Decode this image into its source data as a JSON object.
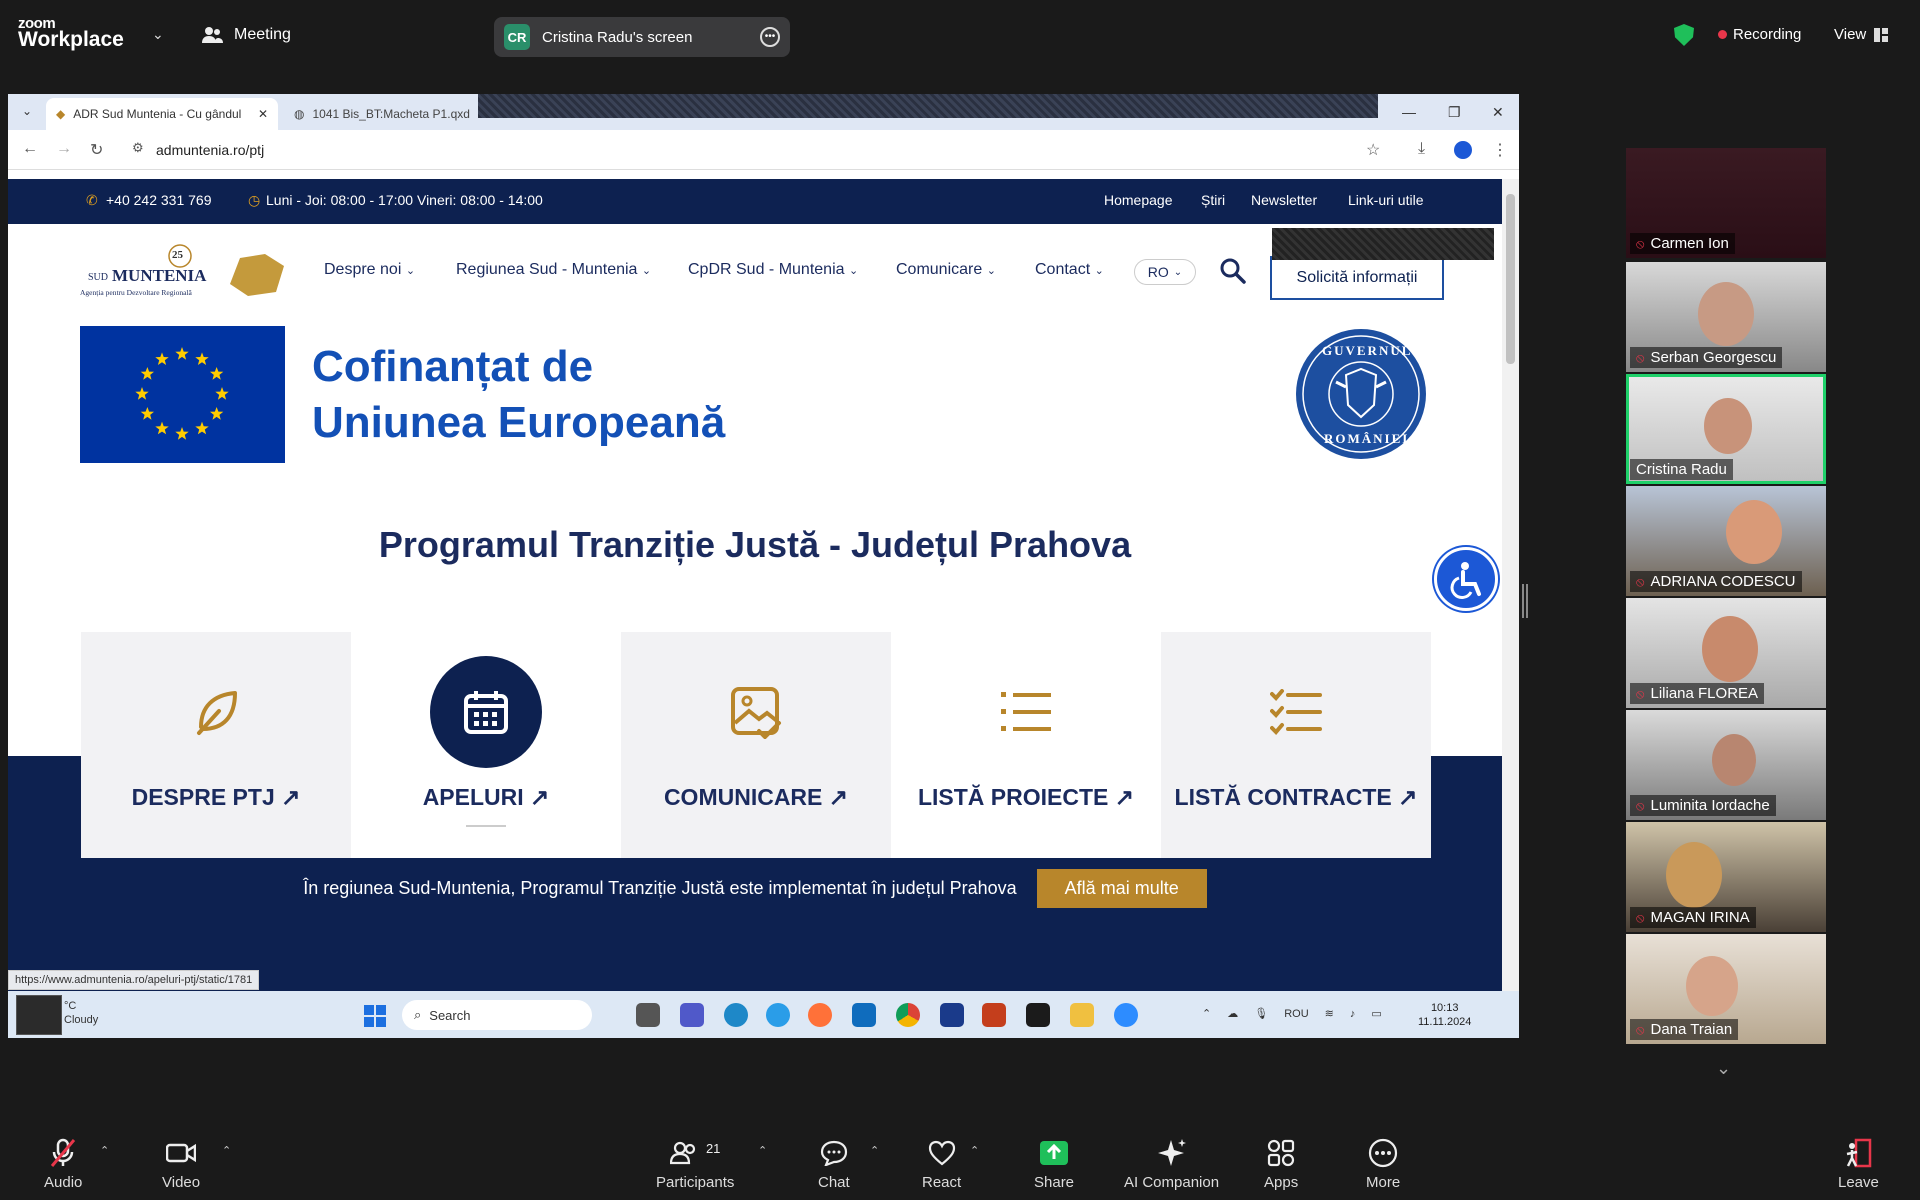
{
  "zoom": {
    "brand_top": "zoom",
    "brand_bottom": "Workplace",
    "meeting_label": "Meeting",
    "screen_initials": "CR",
    "screen_owner": "Cristina Radu's screen",
    "recording_label": "Recording",
    "view_label": "View"
  },
  "browser": {
    "tab1": "ADR Sud Muntenia - Cu gândul",
    "tab2": "1041 Bis_BT:Macheta P1.qxd",
    "url": "admuntenia.ro/ptj",
    "status_url": "https://www.admuntenia.ro/apeluri-ptj/static/1781"
  },
  "site": {
    "phone": "+40 242 331 769",
    "hours": "Luni - Joi: 08:00 - 17:00 Vineri: 08:00 - 14:00",
    "toplinks": [
      "Homepage",
      "Știri",
      "Newsletter",
      "Link-uri utile"
    ],
    "logo_badge": "25",
    "logo_sud": "SUD",
    "logo_name": "MUNTENIA",
    "logo_sub": "Agenția pentru Dezvoltare Regională",
    "nav": [
      "Despre noi",
      "Regiunea Sud - Muntenia",
      "CpDR Sud - Muntenia",
      "Comunicare",
      "Contact"
    ],
    "lang": "RO",
    "cta": "Solicită informații",
    "cofin_line1": "Cofinanțat de",
    "cofin_line2": "Uniunea Europeană",
    "gov_top": "GUVERNUL",
    "gov_bottom": "ROMÂNIEI",
    "page_title": "Programul Tranziție Justă - Județul Prahova",
    "cards": [
      "DESPRE PTJ",
      "APELURI",
      "COMUNICARE",
      "LISTĂ PROIECTE",
      "LISTĂ CONTRACTE"
    ],
    "band_text": "În regiunea Sud-Muntenia, Programul Tranziție Justă este implementat în județul Prahova",
    "band_button": "Află mai multe"
  },
  "taskbar": {
    "weather_temp": "°C",
    "weather_desc": "Cloudy",
    "search": "Search",
    "lang": "ROU",
    "time": "10:13",
    "date": "11.11.2024"
  },
  "participants": [
    "Carmen Ion",
    "Serban Georgescu",
    "Cristina Radu",
    "ADRIANA CODESCU",
    "Liliana FLOREA",
    "Luminita Iordache",
    "MAGAN IRINA",
    "Dana Traian"
  ],
  "toolbar": {
    "audio": "Audio",
    "video": "Video",
    "participants": "Participants",
    "participants_count": "21",
    "chat": "Chat",
    "react": "React",
    "share": "Share",
    "ai": "AI Companion",
    "apps": "Apps",
    "more": "More",
    "leave": "Leave"
  },
  "colors": {
    "site_navy": "#0d2150",
    "gold": "#b8862b",
    "eu_blue": "#0033a0",
    "active_speaker": "#1fd16a",
    "share_green": "#1fbf5a"
  }
}
